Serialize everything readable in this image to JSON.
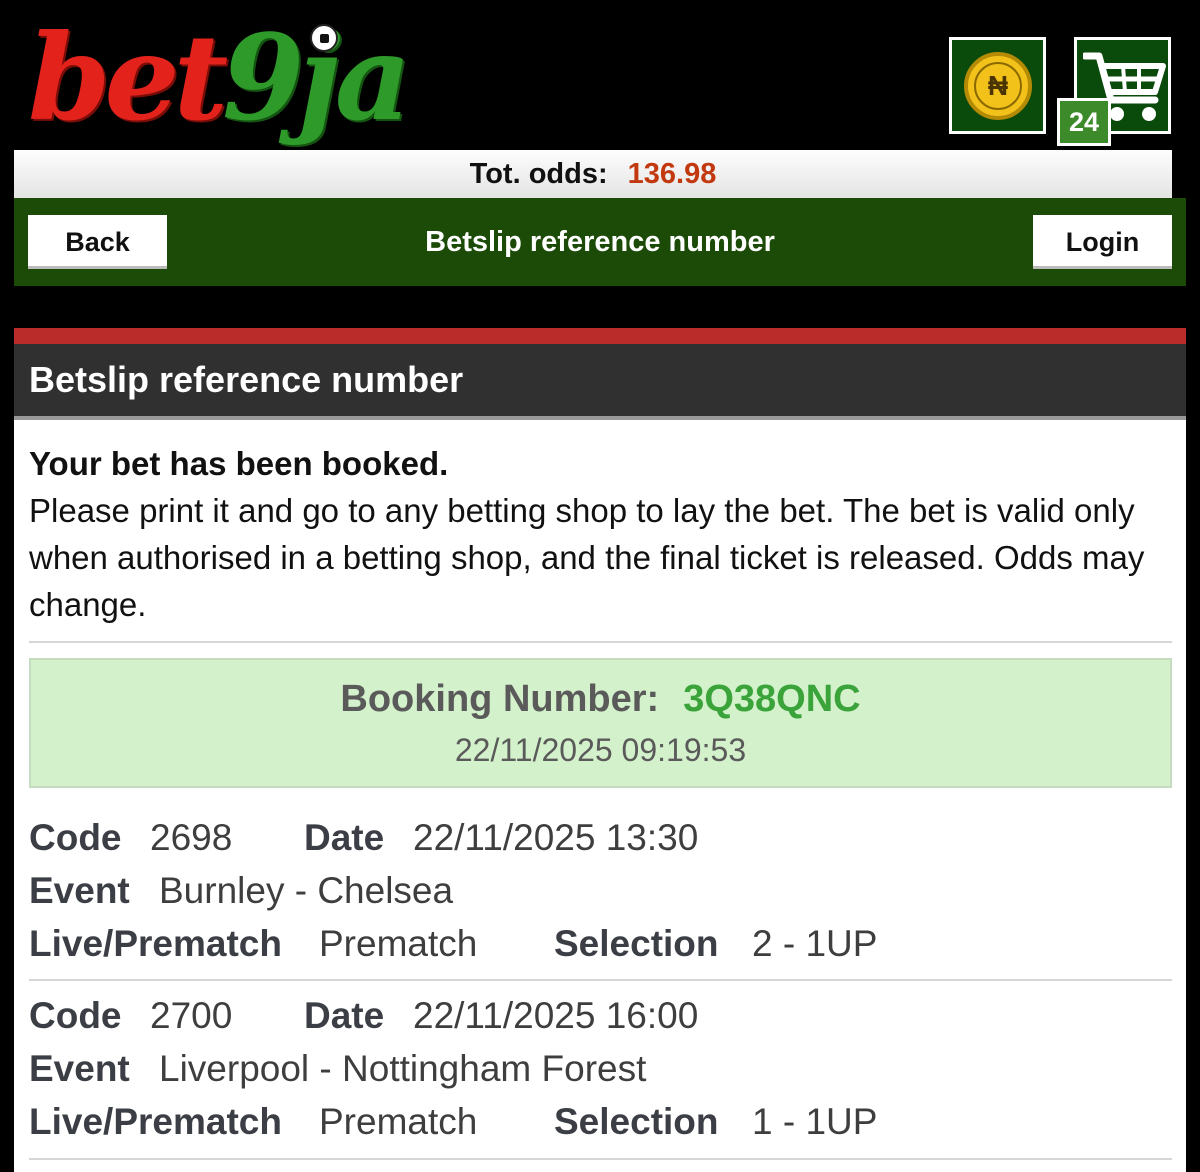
{
  "brand": {
    "logo_part1": "bet",
    "logo_part2": "9ja"
  },
  "header": {
    "wallet_symbol": "₦",
    "cart_count": "24"
  },
  "odds": {
    "label": "Tot. odds:",
    "value": "136.98"
  },
  "nav": {
    "back": "Back",
    "title": "Betslip reference number",
    "login": "Login"
  },
  "section": {
    "title": "Betslip reference number"
  },
  "message": {
    "title": "Your bet has been booked.",
    "body": "Please print it and go to any betting shop to lay the bet. The bet is valid only when authorised in a betting shop, and the final ticket is released. Odds may change."
  },
  "booking": {
    "label": "Booking Number:",
    "number": "3Q38QNC",
    "timestamp": "22/11/2025 09:19:53"
  },
  "labels": {
    "code": "Code",
    "date": "Date",
    "event": "Event",
    "live": "Live/Prematch",
    "selection": "Selection"
  },
  "bets": [
    {
      "code": "2698",
      "date": "22/11/2025 13:30",
      "event": "Burnley - Chelsea",
      "live": "Prematch",
      "selection": "2 - 1UP"
    },
    {
      "code": "2700",
      "date": "22/11/2025 16:00",
      "event": "Liverpool - Nottingham Forest",
      "live": "Prematch",
      "selection": "1 - 1UP"
    }
  ],
  "colors": {
    "accent_green": "#1c4a07",
    "brand_red": "#e3221b",
    "brand_green": "#2e9a2a",
    "odds_red": "#c2390f",
    "booking_bg": "#d3f1ca"
  }
}
